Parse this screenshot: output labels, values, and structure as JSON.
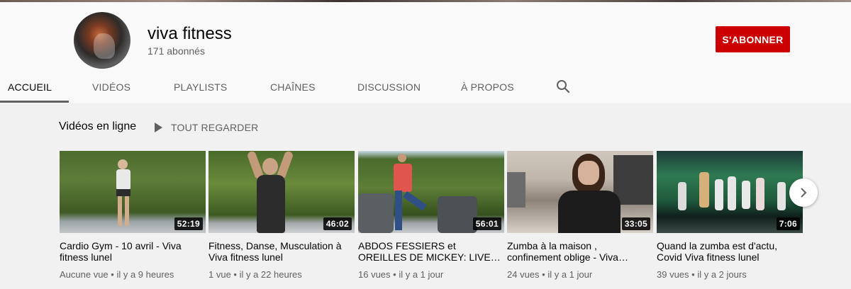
{
  "channel": {
    "name": "viva fitness",
    "subscribers": "171 abonnés",
    "subscribe_label": "S'ABONNER"
  },
  "tabs": [
    {
      "label": "ACCUEIL",
      "active": true
    },
    {
      "label": "VIDÉOS",
      "active": false
    },
    {
      "label": "PLAYLISTS",
      "active": false
    },
    {
      "label": "CHAÎNES",
      "active": false
    },
    {
      "label": "DISCUSSION",
      "active": false
    },
    {
      "label": "À PROPOS",
      "active": false
    }
  ],
  "search_icon": "search-icon",
  "shelf": {
    "title": "Vidéos en ligne",
    "play_all_label": "TOUT REGARDER",
    "videos": [
      {
        "title": "Cardio Gym - 10 avril - Viva fitness lunel",
        "duration": "52:19",
        "views": "Aucune vue",
        "age": "il y a 9 heures"
      },
      {
        "title": "Fitness, Danse, Musculation à Viva fitness lunel",
        "duration": "46:02",
        "views": "1 vue",
        "age": "il y a 22 heures"
      },
      {
        "title": "ABDOS FESSIERS et OREILLES DE MICKEY: LIVE…",
        "duration": "56:01",
        "views": "16 vues",
        "age": "il y a 1 jour"
      },
      {
        "title": "Zumba à la maison , confinement oblige - Viva…",
        "duration": "33:05",
        "views": "24 vues",
        "age": "il y a 1 jour"
      },
      {
        "title": "Quand la zumba est d'actu, Covid Viva fitness lunel",
        "duration": "7:06",
        "views": "39 vues",
        "age": "il y a 2 jours"
      }
    ]
  },
  "meta_separator": " • ",
  "colors": {
    "accent_red": "#cc0000",
    "background": "#f9f9f9",
    "shelf_background": "#f1f1f1",
    "muted_text": "#606060"
  }
}
